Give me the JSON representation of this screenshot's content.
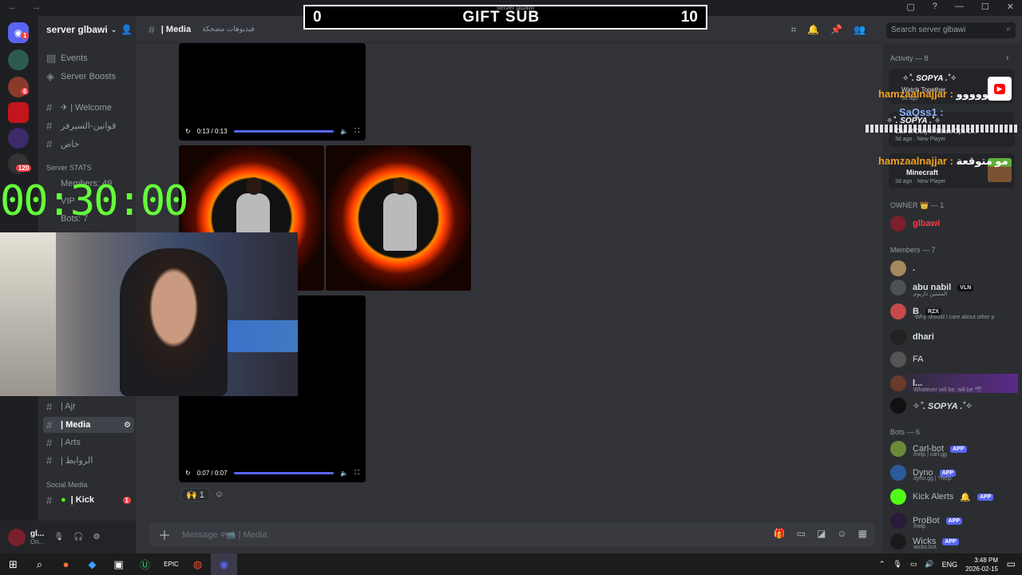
{
  "window": {
    "nav_arrows": "← →",
    "controls": [
      "▢",
      "?",
      "—",
      "☐",
      "✕"
    ]
  },
  "overlay": {
    "left_count": "0",
    "title": "GIFT SUB",
    "right_count": "10",
    "small_text": "server glbawi"
  },
  "server": {
    "name": "server glbawi"
  },
  "channels": {
    "top": [
      {
        "icon": "calendar-icon",
        "label": "Events"
      },
      {
        "icon": "boost-icon",
        "label": "Server Boosts"
      },
      {
        "icon": "hash",
        "label": "✈ | Welcome"
      },
      {
        "icon": "hash",
        "label": "قوانين-السيرفر"
      },
      {
        "icon": "hash",
        "label": "خاص"
      }
    ],
    "stats_category": "Server STATS",
    "stats": [
      "Members: 49",
      "VIP",
      "Bots: 7"
    ],
    "lower": [
      {
        "label": "| Ajr"
      },
      {
        "label": "| Media",
        "active": true
      },
      {
        "label": "| Arts"
      },
      {
        "label": "| الروابط"
      }
    ],
    "social_category": "Social Media",
    "social": [
      {
        "label": "| Kick",
        "badge": "1"
      }
    ]
  },
  "header": {
    "channel": "| Media",
    "topic": "فيديوهات مضحكة"
  },
  "search": {
    "placeholder": "Search server glbawi"
  },
  "videos": [
    {
      "time": "0:13 / 0:13"
    },
    {
      "time": "0:07 / 0:07"
    }
  ],
  "reaction": {
    "emoji": "🙌",
    "count": "1"
  },
  "composer": {
    "placeholder": "Message #📹 | Media"
  },
  "user": {
    "name": "gl...",
    "status": "On..."
  },
  "timer": "00:30:00",
  "activity": {
    "label": "Activity — 8",
    "card1_title": "Watch Together",
    "card1_sub": "3d ago",
    "card2_title": "Call of Duty®: Black Ops C...",
    "card2_sub": "3d ago · New Player",
    "card3_title": "Minecraft",
    "card3_sub": "3d ago · New Player"
  },
  "chat_overlay": [
    {
      "user": "hamzaalnajjar :",
      "text": "حووووو"
    },
    {
      "user": "SaQss1 :",
      "text": ""
    },
    {
      "user": "hamzaalnajjar :",
      "text": "مو متوقعة"
    }
  ],
  "stream_lines": [
    "✧˚. SOPYA .˚✧",
    "✧˚. SOPYA .˚✧"
  ],
  "owner": {
    "label": "OWNER 👑 — 1",
    "name": "glbawi"
  },
  "members_label": "Members — 7",
  "members": [
    {
      "name": ".",
      "sub": ""
    },
    {
      "name": "abu nabil",
      "tag": "VLN",
      "sub": "المثبتين داريوم"
    },
    {
      "name": "B",
      "tag": "RZX",
      "sub": "-Why should I care about other p"
    },
    {
      "name": "dhari",
      "sub": ""
    },
    {
      "name": "FA",
      "sub": ""
    },
    {
      "name": "l...",
      "sub": "Whatever will be, will be.🕊"
    },
    {
      "name": "✧˚. SOPYA .˚✧",
      "sub": ""
    }
  ],
  "bots_label": "Bots — 6",
  "bots": [
    {
      "name": "Carl-bot",
      "tag": "APP",
      "sub": "/help | carl.gg"
    },
    {
      "name": "Dyno",
      "tag": "APP",
      "sub": "dyno.gg | ?help"
    },
    {
      "name": "Kick Alerts",
      "tag": "APP",
      "sub": ""
    },
    {
      "name": "ProBot",
      "tag": "APP",
      "sub": "/help"
    },
    {
      "name": "Wicks",
      "tag": "APP",
      "sub": "wicks.bot"
    }
  ],
  "taskbar": {
    "lang": "ENG",
    "time": "3:48 PM",
    "date": "2026-02-15"
  },
  "colors": {
    "accent": "#5865f2",
    "timer": "#65ff3a",
    "owner_name": "#f23f43",
    "chat_user": "#f0a020"
  }
}
